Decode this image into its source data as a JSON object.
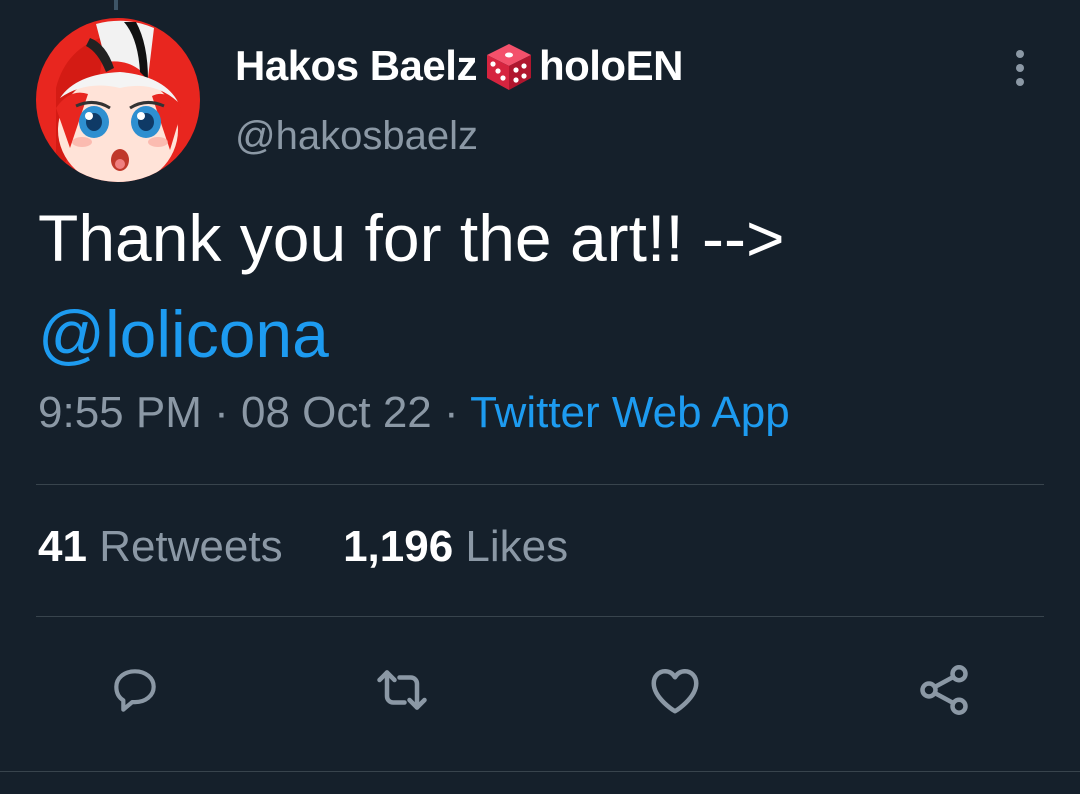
{
  "tweet": {
    "author": {
      "display_name_prefix": "Hakos Baelz",
      "display_name_suffix": "holoEN",
      "emoji": "dice-icon",
      "handle": "@hakosbaelz"
    },
    "text": "Thank you for the art!! -->",
    "mention": "@lolicona",
    "time": "9:55 PM",
    "separator": "·",
    "date": "08 Oct 22",
    "source": "Twitter Web App",
    "stats": {
      "retweets_count": "41",
      "retweets_label": "Retweets",
      "likes_count": "1,196",
      "likes_label": "Likes"
    }
  },
  "actions": [
    "reply-icon",
    "retweet-icon",
    "like-icon",
    "share-icon"
  ],
  "colors": {
    "background": "#15202b",
    "text_primary": "#ffffff",
    "text_secondary": "#8b98a5",
    "accent": "#1d9bf0",
    "divider": "#38444d"
  }
}
